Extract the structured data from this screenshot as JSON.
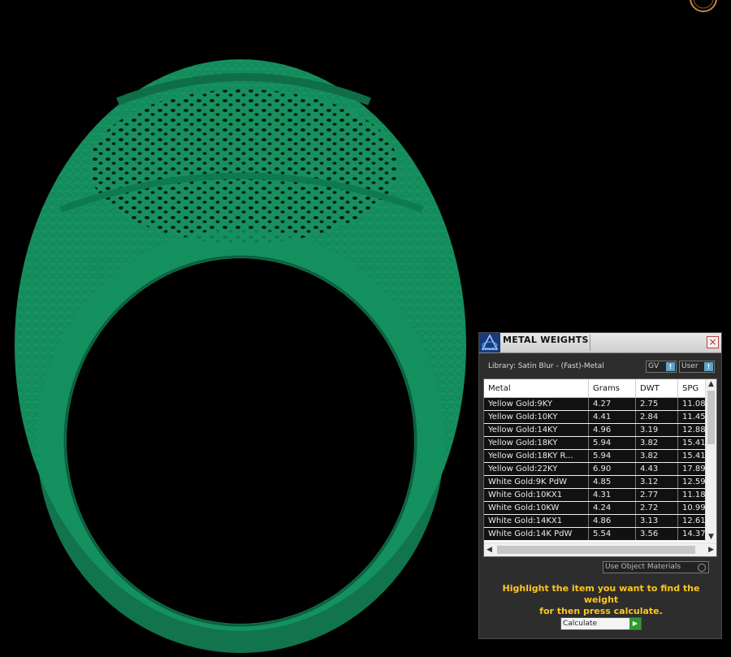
{
  "colors": {
    "model_green": "#138a5a",
    "hint_yellow": "#ffc61f",
    "panel_bg": "#2d2d2d"
  },
  "icons": {
    "nav": "navigation-gizmo-icon",
    "logo": "app-logo-icon",
    "close": "close-icon"
  },
  "panel": {
    "title": "METAL WEIGHTS",
    "library": "Library: Satin Blur - (Fast)-Metal",
    "gv_label": "GV",
    "user_label": "User",
    "columns": [
      "Metal",
      "Grams",
      "DWT",
      "SPG"
    ],
    "rows": [
      [
        "Yellow Gold:9KY",
        "4.27",
        "2.75",
        "11.08"
      ],
      [
        "Yellow Gold:10KY",
        "4.41",
        "2.84",
        "11.45"
      ],
      [
        "Yellow Gold:14KY",
        "4.96",
        "3.19",
        "12.88"
      ],
      [
        "Yellow Gold:18KY",
        "5.94",
        "3.82",
        "15.41"
      ],
      [
        "Yellow Gold:18KY R...",
        "5.94",
        "3.82",
        "15.41"
      ],
      [
        "Yellow Gold:22KY",
        "6.90",
        "4.43",
        "17.89"
      ],
      [
        "White Gold:9K PdW",
        "4.85",
        "3.12",
        "12.59"
      ],
      [
        "White Gold:10KX1",
        "4.31",
        "2.77",
        "11.18"
      ],
      [
        "White Gold:10KW",
        "4.24",
        "2.72",
        "10.99"
      ],
      [
        "White Gold:14KX1",
        "4.86",
        "3.13",
        "12.61"
      ],
      [
        "White Gold:14K PdW",
        "5.54",
        "3.56",
        "14.37"
      ]
    ],
    "use_object_materials": "Use Object Materials",
    "hint_line1": "Highlight the item you want to find the weight",
    "hint_line2": "for then press calculate.",
    "calculate_label": "Calculate"
  }
}
